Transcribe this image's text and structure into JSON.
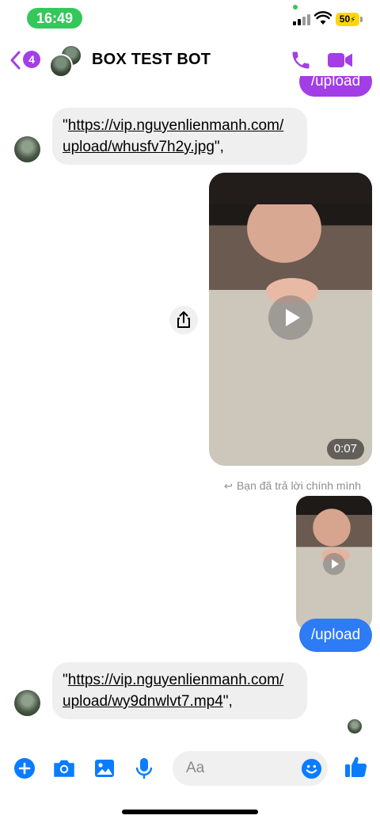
{
  "status_bar": {
    "time": "16:49",
    "battery": "50",
    "colors": {
      "time_pill": "#34c759",
      "battery": "#ffd60a"
    },
    "icons": [
      "signal-icon",
      "wifi-icon",
      "battery-icon"
    ]
  },
  "header": {
    "back_badge": "4",
    "title": "BOX TEST BOT",
    "icons": [
      "back-chevron-icon",
      "phone-icon",
      "video-camera-icon"
    ],
    "accent": "#a33ee8"
  },
  "messages": {
    "top_sent": "/upload",
    "bot_reply_1": {
      "prefix": "\"",
      "link": "https://vip.nguyenlienmanh.com/upload/whusfv7h2y.jpg",
      "link_line1": "https://vip.nguyenlienmanh.com/",
      "link_line2": "upload/whusfv7h2y.jpg",
      "suffix": "\","
    },
    "video": {
      "duration": "0:07"
    },
    "reply_note": "Bạn đã trả lời chính mình",
    "sent_upload": "/upload",
    "bot_reply_2": {
      "prefix": "\"",
      "link": "https://vip.nguyenlienmanh.com/upload/wy9dnwlvt7.mp4",
      "link_line1": "https://vip.nguyenlienmanh.com/",
      "link_line2": "upload/wy9dnwlvt7.mp4",
      "suffix": "\","
    },
    "colors": {
      "sent_purple": "#a23ee6",
      "sent_blue": "#2e7bf6",
      "received_bg": "#efefef"
    }
  },
  "composer": {
    "placeholder": "Aa",
    "icons": [
      "plus-icon",
      "camera-icon",
      "gallery-icon",
      "microphone-icon",
      "emoji-icon",
      "thumbs-up-icon"
    ],
    "accent": "#0a7cff"
  }
}
